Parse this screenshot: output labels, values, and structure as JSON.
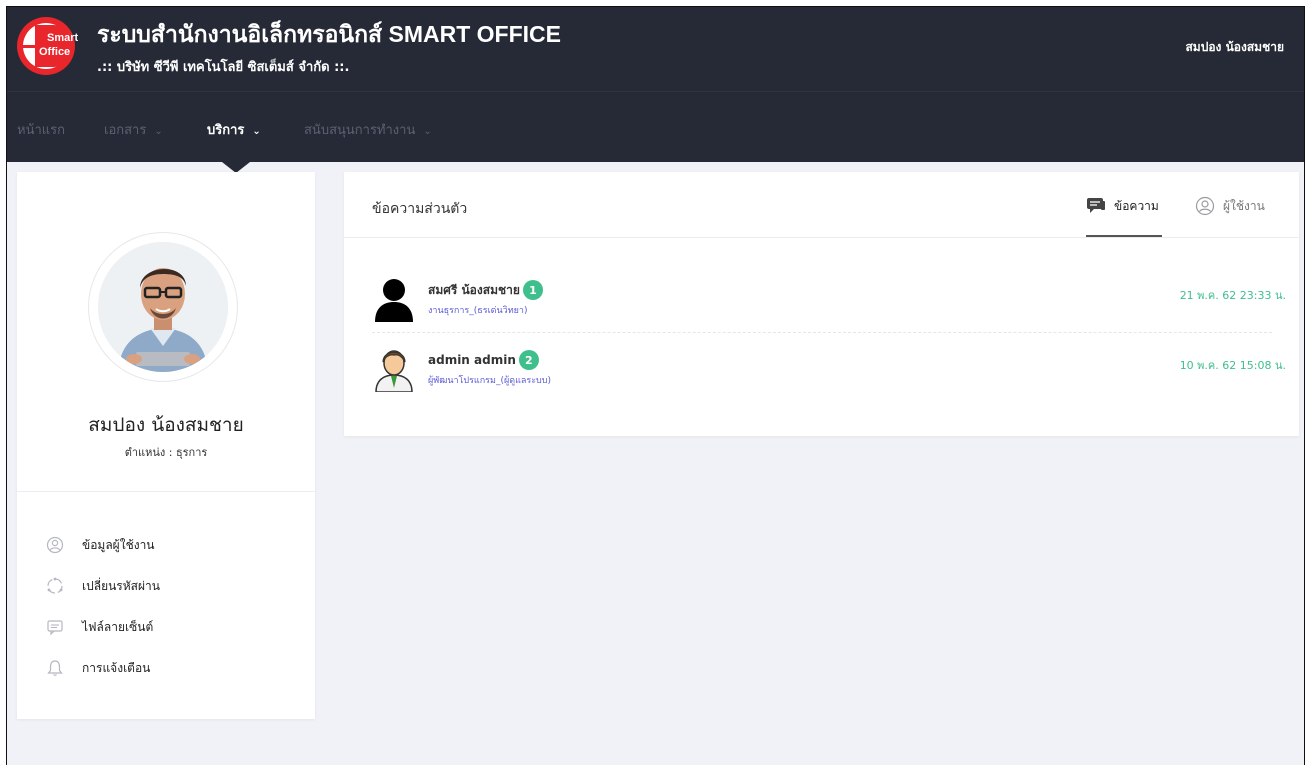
{
  "header": {
    "logo_line1": "Smart",
    "logo_line2": "Office",
    "title": "ระบบสำนักงานอิเล็กทรอนิกส์ SMART OFFICE",
    "subtitle": ".:: บริษัท ซีวีพี เทคโนโลยี ซิสเต็มส์ จำกัด ::.",
    "user_name": "สมปอง น้องสมชาย"
  },
  "nav": {
    "items": [
      {
        "label": "หน้าแรก"
      },
      {
        "label": "เอกสาร"
      },
      {
        "label": "บริการ"
      },
      {
        "label": "สนับสนุนการทำงาน"
      }
    ],
    "active": "บริการ"
  },
  "profile": {
    "name": "สมปอง น้องสมชาย",
    "position": "ตำแหน่ง : ธุรการ",
    "menu": [
      {
        "label": "ข้อมูลผู้ใช้งาน",
        "icon": "user-circle-icon"
      },
      {
        "label": "เปลี่ยนรหัสผ่าน",
        "icon": "refresh-icon"
      },
      {
        "label": "ไฟล์ลายเซ็นต์",
        "icon": "comment-icon"
      },
      {
        "label": "การแจ้งเตือน",
        "icon": "bell-icon"
      }
    ]
  },
  "messages": {
    "title": "ข้อความส่วนตัว",
    "tab_messages": "ข้อความ",
    "tab_users": "ผู้ใช้งาน",
    "rows": [
      {
        "sender": "สมศรี น้องสมชาย",
        "badge": "1",
        "dept": "งานธุรการ_(ธรเด่นวิทยา)",
        "time": "21 พ.ค. 62 23:33 น."
      },
      {
        "sender": "admin admin",
        "badge": "2",
        "dept": "ผู้พัฒนาโปรแกรม_(ผู้ดูแลระบบ)",
        "time": "10 พ.ค. 62 15:08 น."
      }
    ]
  },
  "colors": {
    "topbar": "#262a36",
    "accent_green": "#3fbf8c",
    "link_purple": "#5b5bd6",
    "logo_red": "#e8262b"
  }
}
